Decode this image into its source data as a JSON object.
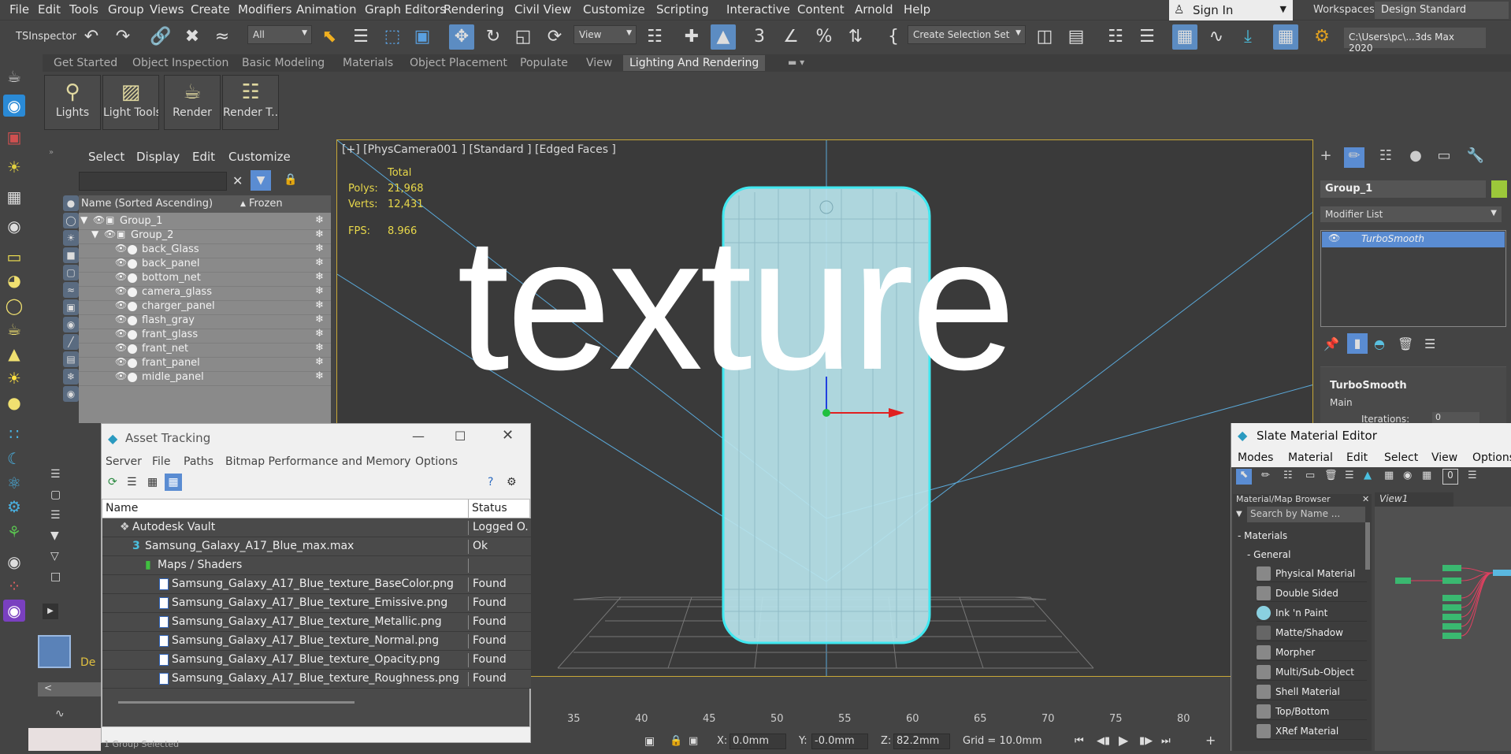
{
  "menubar": {
    "items": [
      "File",
      "Edit",
      "Tools",
      "Group",
      "Views",
      "Create",
      "Modifiers",
      "Animation",
      "Graph Editors",
      "Rendering",
      "Civil View",
      "Customize",
      "Scripting",
      "Interactive",
      "Content",
      "Arnold",
      "Help"
    ],
    "sign_in": "Sign In",
    "workspaces_label": "Workspaces:",
    "workspace_value": "Design Standard"
  },
  "toolbar": {
    "inspector_label": "TSInspector",
    "filter_value": "All",
    "refcoord_value": "View",
    "selection_set": "Create Selection Set",
    "path": "C:\\Users\\pc\\...3ds Max 2020"
  },
  "ribbon": {
    "tabs": [
      "Get Started",
      "Object Inspection",
      "Basic Modeling",
      "Materials",
      "Object Placement",
      "Populate",
      "View",
      "Lighting And Rendering"
    ],
    "buttons": [
      "Lights",
      "Light Tools",
      "Render",
      "Render T..."
    ]
  },
  "scene_explorer": {
    "menu": [
      "Select",
      "Display",
      "Edit",
      "Customize"
    ],
    "col_name": "Name (Sorted Ascending)",
    "col_frozen": "Frozen",
    "rows": [
      "Group_1",
      "Group_2",
      "back_Glass",
      "back_panel",
      "bottom_net",
      "camera_glass",
      "charger_panel",
      "flash_gray",
      "frant_glass",
      "frant_net",
      "frant_panel",
      "midle_panel"
    ]
  },
  "viewport": {
    "label": "[+] [PhysCamera001 ] [Standard ] [Edged Faces ]",
    "total_label": "Total",
    "polys_label": "Polys:",
    "polys_value": "21,968",
    "verts_label": "Verts:",
    "verts_value": "12,431",
    "fps_label": "FPS:",
    "fps_value": "8.966",
    "overlay_word": "texture"
  },
  "command_panel": {
    "object_name": "Group_1",
    "modifier_list": "Modifier List",
    "stack_item": "TurboSmooth",
    "rollout_title": "TurboSmooth",
    "rollout_main": "Main",
    "iterations_label": "Iterations:",
    "iterations_value": "0"
  },
  "asset_tracking": {
    "title": "Asset Tracking",
    "menu": [
      "Server",
      "File",
      "Paths",
      "Bitmap Performance and Memory",
      "Options"
    ],
    "col_name": "Name",
    "col_status": "Status",
    "rows": [
      {
        "name": "Autodesk Vault",
        "status": "Logged O..."
      },
      {
        "name": "Samsung_Galaxy_A17_Blue_max.max",
        "status": "Ok"
      },
      {
        "name": "Maps / Shaders",
        "status": ""
      },
      {
        "name": "Samsung_Galaxy_A17_Blue_texture_BaseColor.png",
        "status": "Found"
      },
      {
        "name": "Samsung_Galaxy_A17_Blue_texture_Emissive.png",
        "status": "Found"
      },
      {
        "name": "Samsung_Galaxy_A17_Blue_texture_Metallic.png",
        "status": "Found"
      },
      {
        "name": "Samsung_Galaxy_A17_Blue_texture_Normal.png",
        "status": "Found"
      },
      {
        "name": "Samsung_Galaxy_A17_Blue_texture_Opacity.png",
        "status": "Found"
      },
      {
        "name": "Samsung_Galaxy_A17_Blue_texture_Roughness.png",
        "status": "Found"
      }
    ]
  },
  "slate": {
    "title": "Slate Material Editor",
    "menu": [
      "Modes",
      "Material",
      "Edit",
      "Select",
      "View",
      "Options"
    ],
    "browser_title": "Material/Map Browser",
    "search_placeholder": "Search by Name ...",
    "materials_header": "- Materials",
    "general_header": "- General",
    "materials": [
      "Physical Material",
      "Double Sided",
      "Ink 'n Paint",
      "Matte/Shadow",
      "Morpher",
      "Multi/Sub-Object",
      "Shell Material",
      "Top/Bottom",
      "XRef Material"
    ],
    "view_tab": "View1",
    "toolbar_counter": "0"
  },
  "timeline": {
    "ticks": [
      "35",
      "40",
      "45",
      "50",
      "55",
      "60",
      "65",
      "70",
      "75",
      "80"
    ]
  },
  "status": {
    "selected": "1 Group Selected",
    "x_label": "X:",
    "x_value": "0.0mm",
    "y_label": "Y:",
    "y_value": "-0.0mm",
    "z_label": "Z:",
    "z_value": "82.2mm",
    "grid": "Grid = 10.0mm"
  },
  "left_extra": {
    "des_label": "De"
  }
}
